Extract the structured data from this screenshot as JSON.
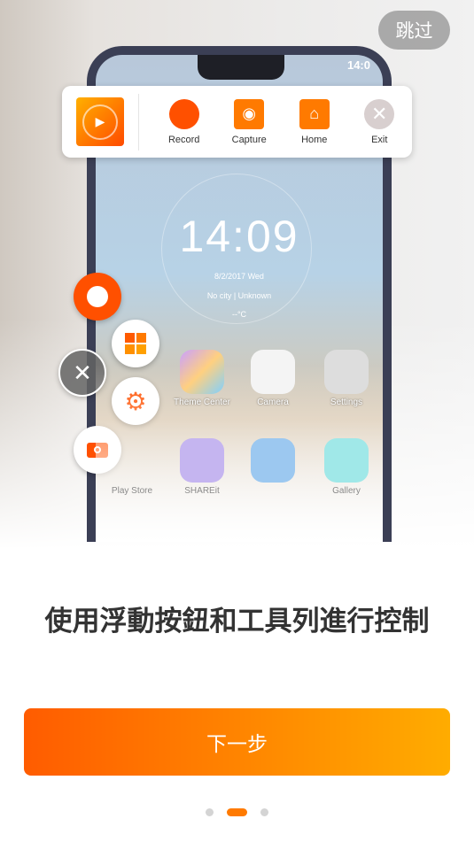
{
  "skip_label": "跳过",
  "illustration": {
    "status_time": "14:0",
    "clock": "14:09",
    "date": "8/2/2017  Wed",
    "location": "No city  |  Unknown",
    "weather": "--°C",
    "apps": [
      "Theme Center",
      "Camera",
      "Settings",
      "Play Store",
      "SHAREit",
      "",
      "Gallery"
    ]
  },
  "toolbar": {
    "items": [
      {
        "label": "Record",
        "icon": "record-icon"
      },
      {
        "label": "Capture",
        "icon": "camera-icon"
      },
      {
        "label": "Home",
        "icon": "home-icon"
      },
      {
        "label": "Exit",
        "icon": "close-icon"
      }
    ]
  },
  "title": "使用浮動按鈕和工具列進行控制",
  "next_label": "下一步",
  "pagination": {
    "current": 2,
    "total": 3
  },
  "colors": {
    "accent": "#ff5c00",
    "gradient_end": "#ffac00"
  }
}
